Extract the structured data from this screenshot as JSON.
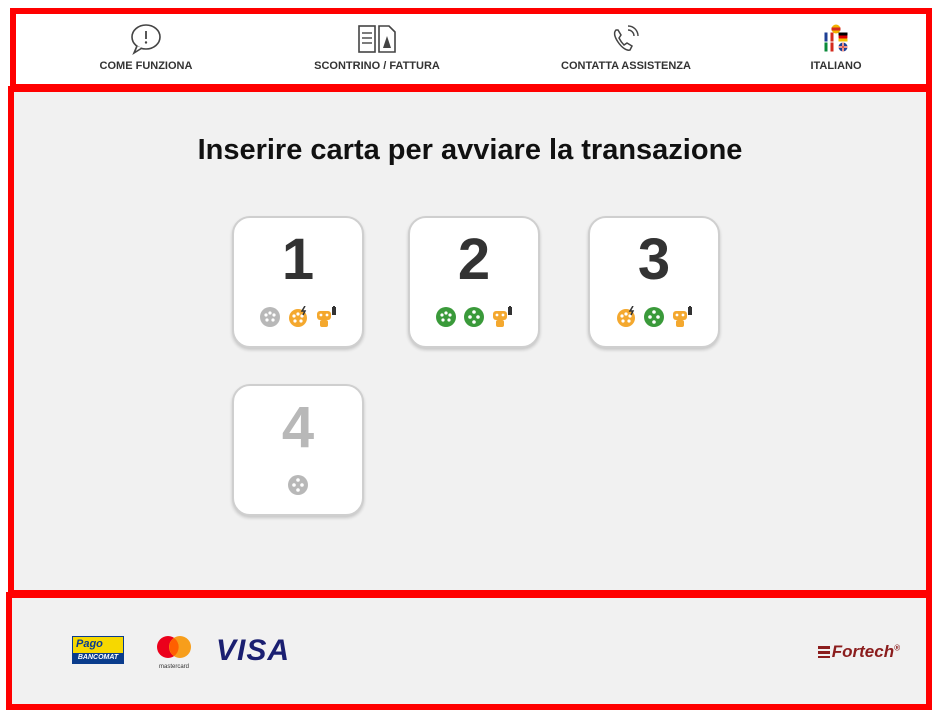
{
  "header": {
    "items": [
      {
        "label": "COME FUNZIONA",
        "icon": "speech-bubble-exclamation-icon"
      },
      {
        "label": "SCONTRINO / FATTURA",
        "icon": "receipt-invoice-icon"
      },
      {
        "label": "CONTATTA ASSISTENZA",
        "icon": "phone-call-icon"
      },
      {
        "label": "ITALIANO",
        "icon": "language-flags-icon"
      }
    ]
  },
  "main": {
    "headline": "Inserire carta per avviare la transazione",
    "stations": [
      {
        "number": "1",
        "status": "available",
        "connectors": [
          "grey-type2-plug-icon",
          "orange-charging-plug-icon",
          "orange-battery-plug-icon"
        ]
      },
      {
        "number": "2",
        "status": "available",
        "connectors": [
          "green-type2-plug-icon",
          "green-plug-icon",
          "orange-battery-plug-icon"
        ]
      },
      {
        "number": "3",
        "status": "available",
        "connectors": [
          "orange-charging-plug-icon",
          "green-plug-icon",
          "orange-battery-plug-icon"
        ]
      },
      {
        "number": "4",
        "status": "disabled",
        "connectors": [
          "grey-plug-icon"
        ]
      }
    ]
  },
  "footer": {
    "payment_logos": [
      {
        "name": "pagobancomat-logo",
        "top": "Pago",
        "bottom": "BANCOMAT"
      },
      {
        "name": "mastercard-logo",
        "text": "mastercard"
      },
      {
        "name": "visa-logo",
        "text": "VISA"
      }
    ],
    "brand": "Fortech",
    "brand_mark": "®"
  },
  "colors": {
    "frame_red": "#ff0000",
    "green": "#3a9a3a",
    "orange": "#f4a82e",
    "grey": "#b8b8b8"
  }
}
